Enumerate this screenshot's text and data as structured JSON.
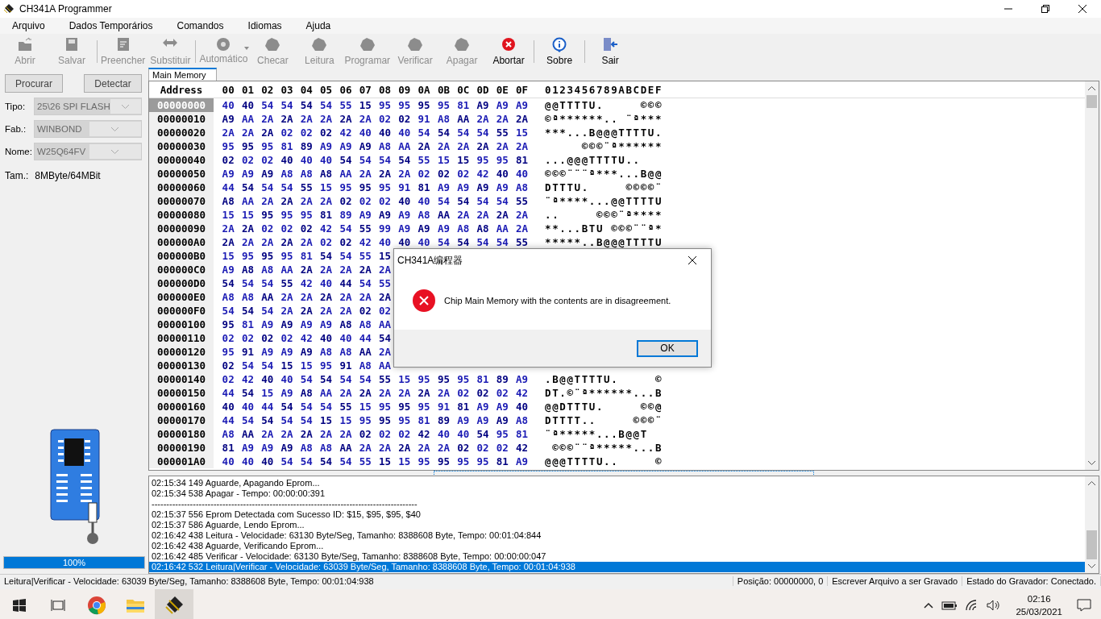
{
  "window": {
    "title": "CH341A Programmer"
  },
  "menu": [
    "Arquivo",
    "Dados Temporários",
    "Comandos",
    "Idiomas",
    "Ajuda"
  ],
  "toolbar": [
    [
      {
        "label": "Abrir",
        "disabled": true,
        "has_menu": false
      },
      {
        "label": "Salvar",
        "disabled": true,
        "has_menu": false
      }
    ],
    [
      {
        "label": "Preencher",
        "disabled": true,
        "has_menu": false
      },
      {
        "label": "Substituir",
        "disabled": true,
        "has_menu": false
      }
    ],
    [
      {
        "label": "Automático",
        "disabled": true,
        "has_menu": true
      },
      {
        "label": "Checar",
        "disabled": true,
        "has_menu": false
      },
      {
        "label": "Leitura",
        "disabled": true,
        "has_menu": false
      },
      {
        "label": "Programar",
        "disabled": true,
        "has_menu": false
      },
      {
        "label": "Verificar",
        "disabled": true,
        "has_menu": false
      },
      {
        "label": "Apagar",
        "disabled": true,
        "has_menu": false
      },
      {
        "label": "Abortar",
        "disabled": false,
        "has_menu": false
      }
    ],
    [
      {
        "label": "Sobre",
        "disabled": false,
        "has_menu": false
      }
    ],
    [
      {
        "label": "Sair",
        "disabled": false,
        "has_menu": false
      }
    ]
  ],
  "left_panel": {
    "buttons": [
      "Procurar",
      "Detectar"
    ],
    "fields": [
      {
        "label": "Tipo:",
        "value": "25\\26 SPI FLASH",
        "disabled": true
      },
      {
        "label": "Fab.:",
        "value": "WINBOND",
        "disabled": true
      },
      {
        "label": "Nome:",
        "value": "W25Q64FV",
        "disabled": true
      }
    ],
    "size": {
      "label": "Tam.:",
      "value": "8MByte/64MBit"
    },
    "progress": {
      "level": 1,
      "reading": "100%"
    }
  },
  "tabs": [
    {
      "label": "Main Memory",
      "selected": true
    }
  ],
  "hex_view": {
    "header": {
      "address": "Address",
      "bytes": [
        "00",
        "01",
        "02",
        "03",
        "04",
        "05",
        "06",
        "07",
        "08",
        "09",
        "0A",
        "0B",
        "0C",
        "0D",
        "0E",
        "0F"
      ],
      "ascii": "0123456789ABCDEF"
    },
    "rows": [
      {
        "address": "00000000",
        "selected": true,
        "bytes": [
          "40",
          "40",
          "54",
          "54",
          "54",
          "54",
          "55",
          "15",
          "95",
          "95",
          "95",
          "95",
          "81",
          "A9",
          "A9",
          "A9"
        ],
        "ascii": "@@TTTTU.     ©©©"
      },
      {
        "address": "00000010",
        "selected": false,
        "bytes": [
          "A9",
          "AA",
          "2A",
          "2A",
          "2A",
          "2A",
          "2A",
          "2A",
          "02",
          "02",
          "91",
          "A8",
          "AA",
          "2A",
          "2A",
          "2A"
        ],
        "ascii": "©ª******.. ¨ª***"
      },
      {
        "address": "00000020",
        "selected": false,
        "bytes": [
          "2A",
          "2A",
          "2A",
          "02",
          "02",
          "02",
          "42",
          "40",
          "40",
          "40",
          "54",
          "54",
          "54",
          "54",
          "55",
          "15"
        ],
        "ascii": "***...B@@@TTTTU."
      },
      {
        "address": "00000030",
        "selected": false,
        "bytes": [
          "95",
          "95",
          "95",
          "81",
          "89",
          "A9",
          "A9",
          "A9",
          "A8",
          "AA",
          "2A",
          "2A",
          "2A",
          "2A",
          "2A",
          "2A"
        ],
        "ascii": "     ©©©¨ª******"
      },
      {
        "address": "00000040",
        "selected": false,
        "bytes": [
          "02",
          "02",
          "02",
          "40",
          "40",
          "40",
          "54",
          "54",
          "54",
          "54",
          "55",
          "15",
          "15",
          "95",
          "95",
          "81"
        ],
        "ascii": "...@@@TTTTU.."
      },
      {
        "address": "00000050",
        "selected": false,
        "bytes": [
          "A9",
          "A9",
          "A9",
          "A8",
          "A8",
          "A8",
          "AA",
          "2A",
          "2A",
          "2A",
          "02",
          "02",
          "02",
          "42",
          "40",
          "40"
        ],
        "ascii": "©©©¨¨¨ª***...B@@"
      },
      {
        "address": "00000060",
        "selected": false,
        "bytes": [
          "44",
          "54",
          "54",
          "54",
          "55",
          "15",
          "95",
          "95",
          "95",
          "91",
          "81",
          "A9",
          "A9",
          "A9",
          "A9",
          "A8"
        ],
        "ascii": "DTTTU.     ©©©©¨"
      },
      {
        "address": "00000070",
        "selected": false,
        "bytes": [
          "A8",
          "AA",
          "2A",
          "2A",
          "2A",
          "2A",
          "02",
          "02",
          "02",
          "40",
          "40",
          "54",
          "54",
          "54",
          "54",
          "55"
        ],
        "ascii": "¨ª****...@@TTTTU"
      },
      {
        "address": "00000080",
        "selected": false,
        "bytes": [
          "15",
          "15",
          "95",
          "95",
          "95",
          "81",
          "89",
          "A9",
          "A9",
          "A9",
          "A8",
          "AA",
          "2A",
          "2A",
          "2A",
          "2A"
        ],
        "ascii": "..     ©©©¨ª****"
      },
      {
        "address": "00000090",
        "selected": false,
        "bytes": [
          "2A",
          "2A",
          "02",
          "02",
          "02",
          "42",
          "54",
          "55",
          "99",
          "A9",
          "A9",
          "A9",
          "A8",
          "A8",
          "AA",
          "2A"
        ],
        "ascii": "**...BTU ©©©¨¨ª*"
      },
      {
        "address": "000000A0",
        "selected": false,
        "bytes": [
          "2A",
          "2A",
          "2A",
          "2A",
          "2A",
          "02",
          "02",
          "42",
          "40",
          "40",
          "40",
          "54",
          "54",
          "54",
          "54",
          "55"
        ],
        "ascii": "*****..B@@@TTTTU"
      },
      {
        "address": "000000B0",
        "selected": false,
        "bytes": [
          "15",
          "95",
          "95",
          "95",
          "81",
          "54",
          "54",
          "55",
          "15"
        ]
      },
      {
        "address": "000000C0",
        "selected": false,
        "bytes": [
          "A9",
          "A8",
          "A8",
          "AA",
          "2A",
          "2A",
          "2A",
          "2A",
          "2A"
        ]
      },
      {
        "address": "000000D0",
        "selected": false,
        "bytes": [
          "54",
          "54",
          "54",
          "55",
          "42",
          "40",
          "44",
          "54",
          "55"
        ]
      },
      {
        "address": "000000E0",
        "selected": false,
        "bytes": [
          "A8",
          "A8",
          "AA",
          "2A",
          "2A",
          "2A",
          "2A",
          "2A",
          "2A"
        ]
      },
      {
        "address": "000000F0",
        "selected": false,
        "bytes": [
          "54",
          "54",
          "54",
          "2A",
          "2A",
          "2A",
          "2A",
          "02",
          "02"
        ]
      },
      {
        "address": "00000100",
        "selected": false,
        "bytes": [
          "95",
          "81",
          "A9",
          "A9",
          "A9",
          "A9",
          "A8",
          "A8",
          "AA"
        ]
      },
      {
        "address": "00000110",
        "selected": false,
        "bytes": [
          "02",
          "02",
          "02",
          "02",
          "42",
          "40",
          "40",
          "44",
          "54"
        ]
      },
      {
        "address": "00000120",
        "selected": false,
        "bytes": [
          "95",
          "91",
          "A9",
          "A9",
          "A9",
          "A8",
          "A8",
          "AA",
          "2A"
        ]
      },
      {
        "address": "00000130",
        "selected": false,
        "bytes": [
          "02",
          "54",
          "54",
          "15",
          "15",
          "95",
          "91",
          "A8",
          "AA"
        ]
      },
      {
        "address": "00000140",
        "selected": false,
        "bytes": [
          "02",
          "42",
          "40",
          "40",
          "54",
          "54",
          "54",
          "54",
          "55",
          "15",
          "95",
          "95",
          "95",
          "81",
          "89",
          "A9"
        ],
        "ascii": ".B@@TTTTU.     ©"
      },
      {
        "address": "00000150",
        "selected": false,
        "bytes": [
          "44",
          "54",
          "15",
          "A9",
          "A8",
          "AA",
          "2A",
          "2A",
          "2A",
          "2A",
          "2A",
          "2A",
          "02",
          "02",
          "02",
          "42"
        ],
        "ascii": "DT.©¨ª******...B"
      },
      {
        "address": "00000160",
        "selected": false,
        "bytes": [
          "40",
          "40",
          "44",
          "54",
          "54",
          "54",
          "55",
          "15",
          "95",
          "95",
          "95",
          "91",
          "81",
          "A9",
          "A9",
          "40"
        ],
        "ascii": "@@DTTTU.     ©©@"
      },
      {
        "address": "00000170",
        "selected": false,
        "bytes": [
          "44",
          "54",
          "54",
          "54",
          "54",
          "15",
          "15",
          "95",
          "95",
          "95",
          "81",
          "89",
          "A9",
          "A9",
          "A9",
          "A8"
        ],
        "ascii": "DTTTT..     ©©©¨"
      },
      {
        "address": "00000180",
        "selected": false,
        "bytes": [
          "A8",
          "AA",
          "2A",
          "2A",
          "2A",
          "2A",
          "2A",
          "02",
          "02",
          "02",
          "42",
          "40",
          "40",
          "54",
          "95",
          "81"
        ],
        "ascii": "¨ª*****...B@@T"
      },
      {
        "address": "00000190",
        "selected": false,
        "bytes": [
          "81",
          "A9",
          "A9",
          "A9",
          "A8",
          "A8",
          "AA",
          "2A",
          "2A",
          "2A",
          "2A",
          "2A",
          "02",
          "02",
          "02",
          "42"
        ],
        "ascii": " ©©©¨¨ª*****...B"
      },
      {
        "address": "000001A0",
        "selected": false,
        "bytes": [
          "40",
          "40",
          "40",
          "54",
          "54",
          "54",
          "54",
          "55",
          "15",
          "15",
          "95",
          "95",
          "95",
          "95",
          "81",
          "A9"
        ],
        "ascii": "@@@TTTTU..     ©"
      }
    ]
  },
  "log": [
    {
      "text": "02:15:34 149 Aguarde, Apagando Eprom...",
      "selected": false
    },
    {
      "text": "02:15:34 538 Apagar - Tempo: 00:00:00:391",
      "selected": false
    },
    {
      "text": "------------------------------------------------------------------------------------------",
      "selected": false
    },
    {
      "text": "02:15:37 556 Eprom Detectada com Sucesso ID: $15, $95, $95, $40",
      "selected": false
    },
    {
      "text": "02:15:37 586 Aguarde, Lendo Eprom...",
      "selected": false
    },
    {
      "text": "02:16:42 438 Leitura - Velocidade: 63130 Byte/Seg, Tamanho: 8388608 Byte, Tempo: 00:01:04:844",
      "selected": false
    },
    {
      "text": "02:16:42 438 Aguarde, Verificando Eprom...",
      "selected": false
    },
    {
      "text": "02:16:42 485 Verificar - Velocidade: 63130 Byte/Seg, Tamanho: 8388608 Byte, Tempo: 00:00:00:047",
      "selected": false
    },
    {
      "text": "02:16:42 532 Leitura|Verificar - Velocidade: 63039 Byte/Seg, Tamanho: 8388608 Byte, Tempo: 00:01:04:938",
      "selected": true
    }
  ],
  "status_bar": [
    "Leitura|Verificar - Velocidade: 63039 Byte/Seg, Tamanho: 8388608 Byte, Tempo: 00:01:04:938",
    "Posição: 00000000, 0",
    "Escrever Arquivo a ser Gravado",
    "Estado do Gravador: Conectado."
  ],
  "dialog": {
    "title": "CH341A编程器",
    "message": "Chip Main Memory with the contents are in disagreement.",
    "buttons": [
      "OK"
    ]
  },
  "taskbar": {
    "apps": [
      {
        "selected": false
      },
      {
        "selected": false
      },
      {
        "selected": false
      },
      {
        "selected": true
      }
    ],
    "time": "02:16",
    "date": "25/03/2021"
  }
}
